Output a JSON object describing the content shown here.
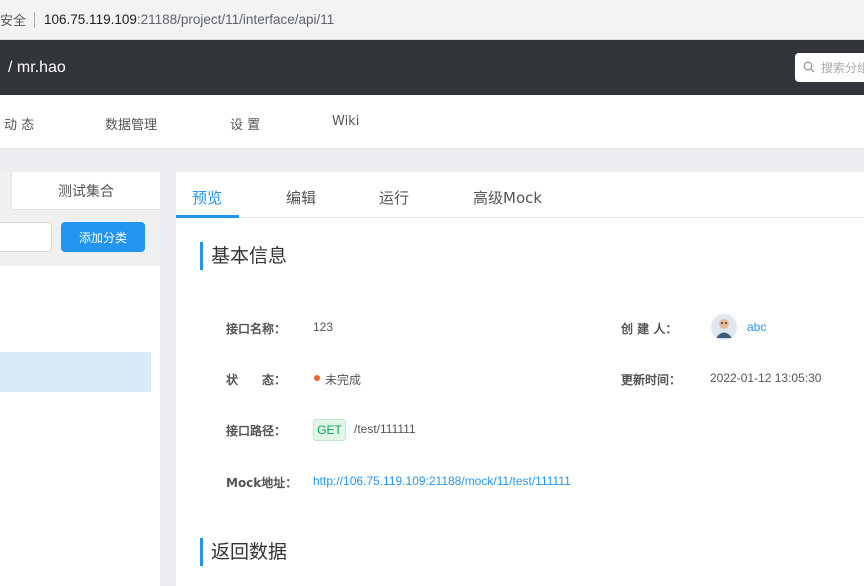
{
  "browser": {
    "security_label": "安全",
    "url_host": "106.75.119.109",
    "url_rest": ":21188/project/11/interface/api/11"
  },
  "header": {
    "breadcrumb": "/  mr.hao",
    "search_placeholder": "搜索分组"
  },
  "nav": {
    "items": [
      "动 态",
      "数据管理",
      "设 置",
      "Wiki"
    ]
  },
  "sidebar": {
    "tab_label": "测试集合",
    "add_button": "添加分类"
  },
  "main": {
    "tabs": [
      "预览",
      "编辑",
      "运行",
      "高级Mock"
    ],
    "active_tab": "预览",
    "section_basic": "基本信息",
    "section_return": "返回数据",
    "fields": {
      "name_label": "接口名称：",
      "name_value": "123",
      "creator_label": "创 建 人：",
      "creator_value": "abc",
      "status_label": "状　　态：",
      "status_value": "未完成",
      "updated_label": "更新时间：",
      "updated_value": "2022-01-12 13:05:30",
      "path_label": "接口路径：",
      "method": "GET",
      "path_value": "/test/111111",
      "mock_label": "Mock地址：",
      "mock_value": "http://106.75.119.109:21188/mock/11/test/111111"
    }
  },
  "colors": {
    "accent": "#2395f1",
    "header_bg": "#32363a",
    "status_dot": "#f5622d",
    "method_green": "#00a854"
  }
}
